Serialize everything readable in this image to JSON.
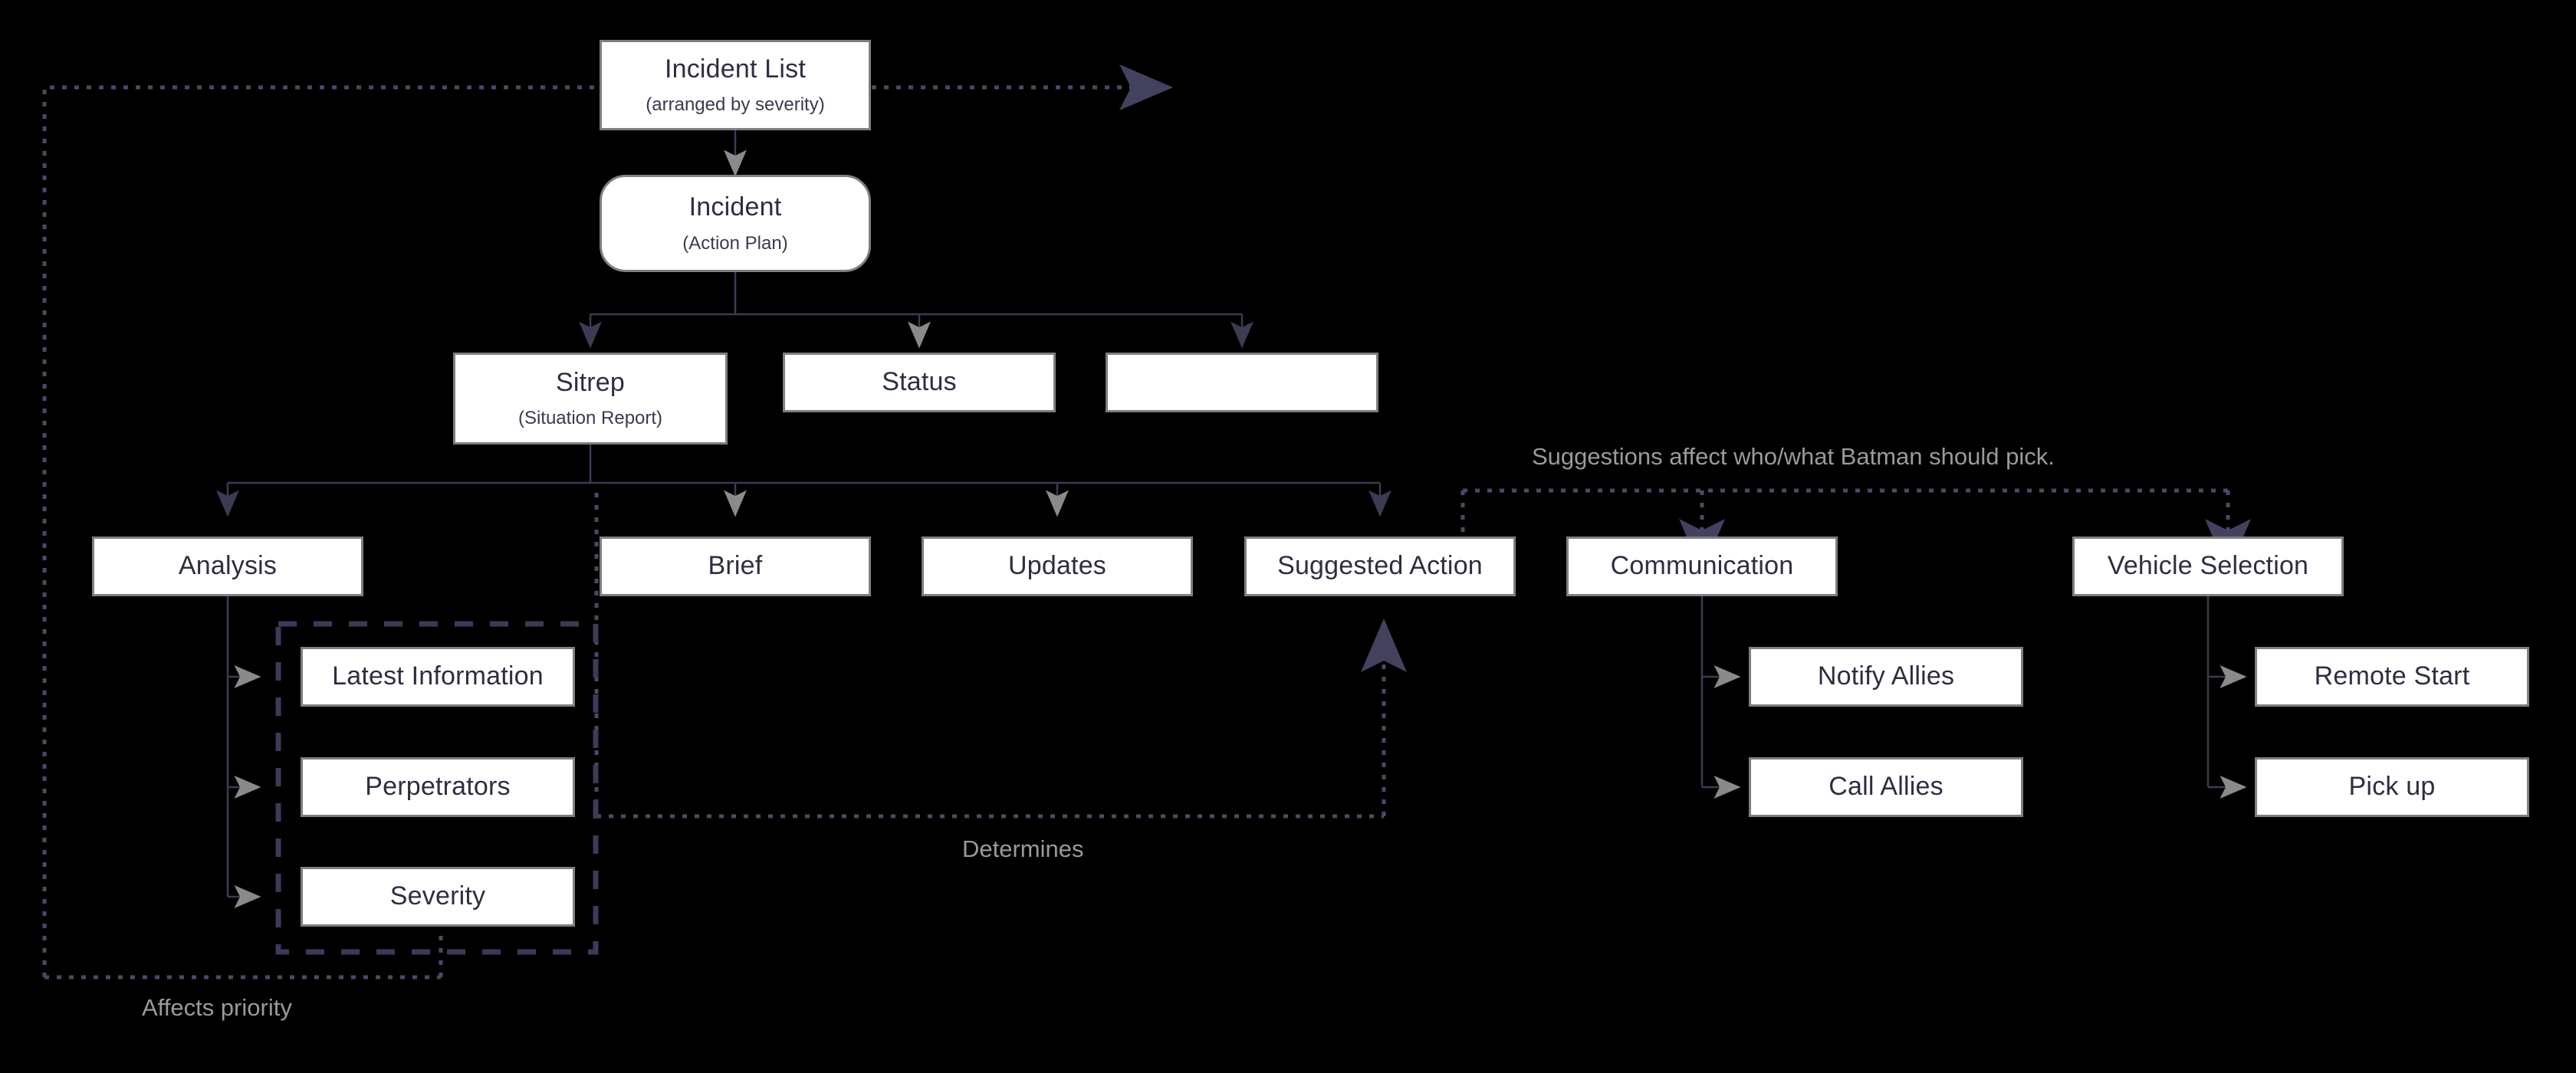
{
  "diagram": {
    "title_caption_top": "Suggestions affect who/what Batman should pick.",
    "caption_determines": "Determines",
    "caption_affects_priority": "Affects priority",
    "colors": {
      "background": "#000000",
      "node_fill": "#ffffff",
      "node_border": "#7f7f7f",
      "node_text": "#2e2e42",
      "connector": "#3b3b52",
      "arrow_grey": "#8a8a8a",
      "caption_text": "#9a9a9a"
    },
    "nodes": [
      {
        "id": "incident-list",
        "title": "Incident List",
        "subtitle": "(arranged by severity)"
      },
      {
        "id": "incident",
        "title": "Incident",
        "subtitle": "(Action Plan)"
      },
      {
        "id": "sitrep",
        "title": "Sitrep",
        "subtitle": "(Situation Report)"
      },
      {
        "id": "status",
        "title": "Status",
        "subtitle": ""
      },
      {
        "id": "unnamed",
        "title": "",
        "subtitle": ""
      },
      {
        "id": "analysis",
        "title": "Analysis",
        "subtitle": ""
      },
      {
        "id": "brief",
        "title": "Brief",
        "subtitle": ""
      },
      {
        "id": "updates",
        "title": "Updates",
        "subtitle": ""
      },
      {
        "id": "suggested-action",
        "title": "Suggested Action",
        "subtitle": ""
      },
      {
        "id": "communication",
        "title": "Communication",
        "subtitle": ""
      },
      {
        "id": "vehicle-selection",
        "title": "Vehicle Selection",
        "subtitle": ""
      },
      {
        "id": "latest-information",
        "title": "Latest Information",
        "subtitle": ""
      },
      {
        "id": "perpetrators",
        "title": "Perpetrators",
        "subtitle": ""
      },
      {
        "id": "severity",
        "title": "Severity",
        "subtitle": ""
      },
      {
        "id": "notify-allies",
        "title": "Notify Allies",
        "subtitle": ""
      },
      {
        "id": "call-allies",
        "title": "Call Allies",
        "subtitle": ""
      },
      {
        "id": "remote-start",
        "title": "Remote Start",
        "subtitle": ""
      },
      {
        "id": "pick-up",
        "title": "Pick up",
        "subtitle": ""
      }
    ]
  }
}
